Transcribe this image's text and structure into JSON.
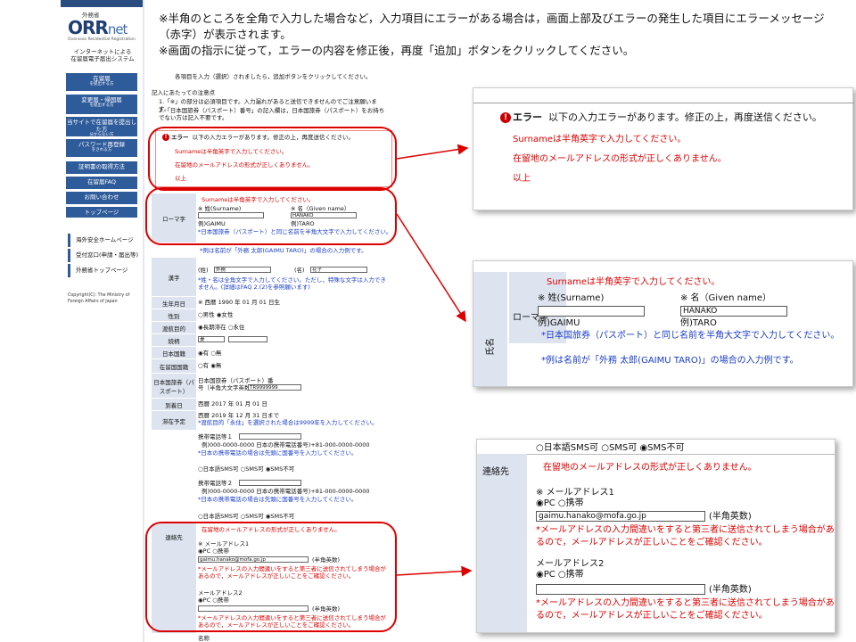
{
  "instructions": {
    "line1": "※半角のところを全角で入力した場合など，入力項目にエラーがある場合は，画面上部及びエラーの発生した項目にエラーメッセージ（赤字）が表示されます。",
    "line2": "※画面の指示に従って，エラーの内容を修正後，再度「追加」ボタンをクリックしてください。"
  },
  "sidebar": {
    "ministry": "外務省",
    "logo_main": "ORR",
    "logo_net": "net",
    "logo_sub": "Overseas Residential Registration",
    "system_name": "インターネットによる\n在留届電子届出システム",
    "nav": [
      {
        "label": "在留届",
        "sub": "を提出する方"
      },
      {
        "label": "変更届・帰国届",
        "sub": "を提出する方"
      },
      {
        "label": "当サイトで在留届を提出した方",
        "sub": "分からない方"
      },
      {
        "label": "パスワード再登録",
        "sub": "をされる方"
      },
      {
        "label": "証明書の取得方法",
        "sub": ""
      },
      {
        "label": "在留届FAQ",
        "sub": ""
      },
      {
        "label": "お問い合わせ",
        "sub": ""
      },
      {
        "label": "トップページ",
        "sub": ""
      }
    ],
    "links": [
      "海外安全ホームページ",
      "受付窓口(申請・届出等)",
      "外務省トップページ"
    ],
    "copyright": "Copyright(C): The Ministry of Foreign Affairs of Japan"
  },
  "form": {
    "header_note": "各項目を入力（選択）されましたら，追加ボタンをクリックしてください。",
    "notes_title": "記入にあたっての注意点",
    "note1": "1.「※」の部分は必須項目です。入力漏れがあると送信できませんのでご注意願います。",
    "note2": "2.「日本国旅券（パスポート）番号」の記入欄は，日本国旅券（パスポート）をお持ちでない方は記入不要です。",
    "error_title": "エラー",
    "error_msg": "以下の入力エラーがあります。修正の上，再度送信ください。",
    "error1": "Surnameは半角英字で入力してください。",
    "error2": "在留地のメールアドレスの形式が正しくありません。",
    "error_end": "以上",
    "name_label": "氏名",
    "romaji_label": "ローマ字",
    "surname_label": "※ 姓(Surname)",
    "given_label": "※ 名（Given name）",
    "surname_value": "",
    "given_value": "HANAKO",
    "ex_surname": "例)GAIMU",
    "ex_given": "例)TARO",
    "passport_note": "*日本国旅券（パスポート）と同じ名前を半角大文字で入力してください。",
    "example_note": "*例は名前が「外務 太郎(GAIMU TARO)」の場合の入力例です。",
    "kanji_label": "漢字",
    "kanji_sei": "(姓)",
    "kanji_mei": "(名)",
    "kanji_sei_value": "外務",
    "kanji_mei_value": "花子",
    "kanji_note": "*姓・名は全角文字で入力してください。ただし，特殊な文字は入力できません。(詳細はFAQ 2.(2)を参照願います)",
    "birth_label": "生年月日",
    "birth_value": "※ 西暦 1990 年 01 月 01 日生",
    "gender_label": "性別",
    "gender_value": "○男性 ◉女性",
    "purpose_label": "渡航目的",
    "purpose_value": "◉長期滞在 ○永住",
    "job_label": "続柄",
    "job_value": "妻",
    "nationality_label": "日本国籍",
    "nationality_value": "◉有 ○無",
    "other_nat_label": "在留国国籍",
    "other_nat_value": "○有 ◉無",
    "passport_label": "日本国旅券（パスポート）",
    "passport_field": "日本国旅券（パスポート）番号（半角大文字英数）",
    "passport_value": "TR9999999",
    "arrival_label": "到着日",
    "arrival_value": "西暦 2017 年 01 月 01 日",
    "stay_label": "滞在予定",
    "stay_value": "西暦 2019 年 12 月 31 日まで",
    "stay_note": "*渡航目的「永住」を選択された場合は9999年を入力してください。",
    "phone1_label": "携帯電話等１",
    "phone_ex": "例)000-0000-0000 日本の携帯電話番号)+81-000-0000-0000",
    "phone_note": "*日本の携帯電話の場合は先頭に国番号を入力してください。",
    "sms_options": "○日本語SMS可 ○SMS可 ◉SMS不可",
    "phone2_label": "携帯電話等２",
    "contact_label": "連絡先",
    "email_error": "在留地のメールアドレスの形式が正しくありません。",
    "email1_label": "※ メールアドレス1",
    "email_type": "◉PC ○携帯",
    "email1_value": "gaimu.hanako@mofa.go.jp",
    "email_hankaku": "(半角英数)",
    "email_note": "*メールアドレスの入力間違いをすると第三者に送信されてしまう場合があるので，メールアドレスが正しいことをご確認ください。",
    "email2_label": "メールアドレス2",
    "email2_value": "",
    "bottom_label": "名称"
  },
  "zoom_error": {
    "title": "エラー",
    "msg": "以下の入力エラーがあります。修正の上，再度送信ください。",
    "e1": "Surnameは半角英字で入力してください。",
    "e2": "在留地のメールアドレスの形式が正しくありません。",
    "end": "以上"
  },
  "zoom_name": {
    "error": "Surnameは半角英字で入力してください。",
    "surname": "※ 姓(Surname)",
    "given": "※ 名（Given name）",
    "surname_value": "",
    "given_value": "HANAKO",
    "ex_s": "例)GAIMU",
    "ex_g": "例)TARO",
    "row_label": "ローマ字",
    "side_label": "氏名",
    "note1": "*日本国旅券（パスポート）と同じ名前を半角大文字で入力してください。",
    "note2": "*例は名前が「外務 太郎(GAIMU TARO)」の場合の入力例です。"
  },
  "zoom_email": {
    "sms": "○日本語SMS可 ○SMS可 ◉SMS不可",
    "label": "連絡先",
    "error": "在留地のメールアドレスの形式が正しくありません。",
    "email1": "※ メールアドレス1",
    "type1": "◉PC ○携帯",
    "email1_value": "gaimu.hanako@mofa.go.jp",
    "hankaku": "(半角英数)",
    "note1a": "*メールアドレスの入力間違いをすると第三者に送信されてしまう場合があ",
    "note1b": "るので，メールアドレスが正しいことをご確認ください。",
    "email2": "メールアドレス2",
    "type2": "◉PC ○携帯",
    "email2_value": ""
  },
  "colors": {
    "error": "#dd0000",
    "nav": "#2e5b9a",
    "annotation": "#dd0000",
    "note_blue": "#1a3cc8"
  }
}
